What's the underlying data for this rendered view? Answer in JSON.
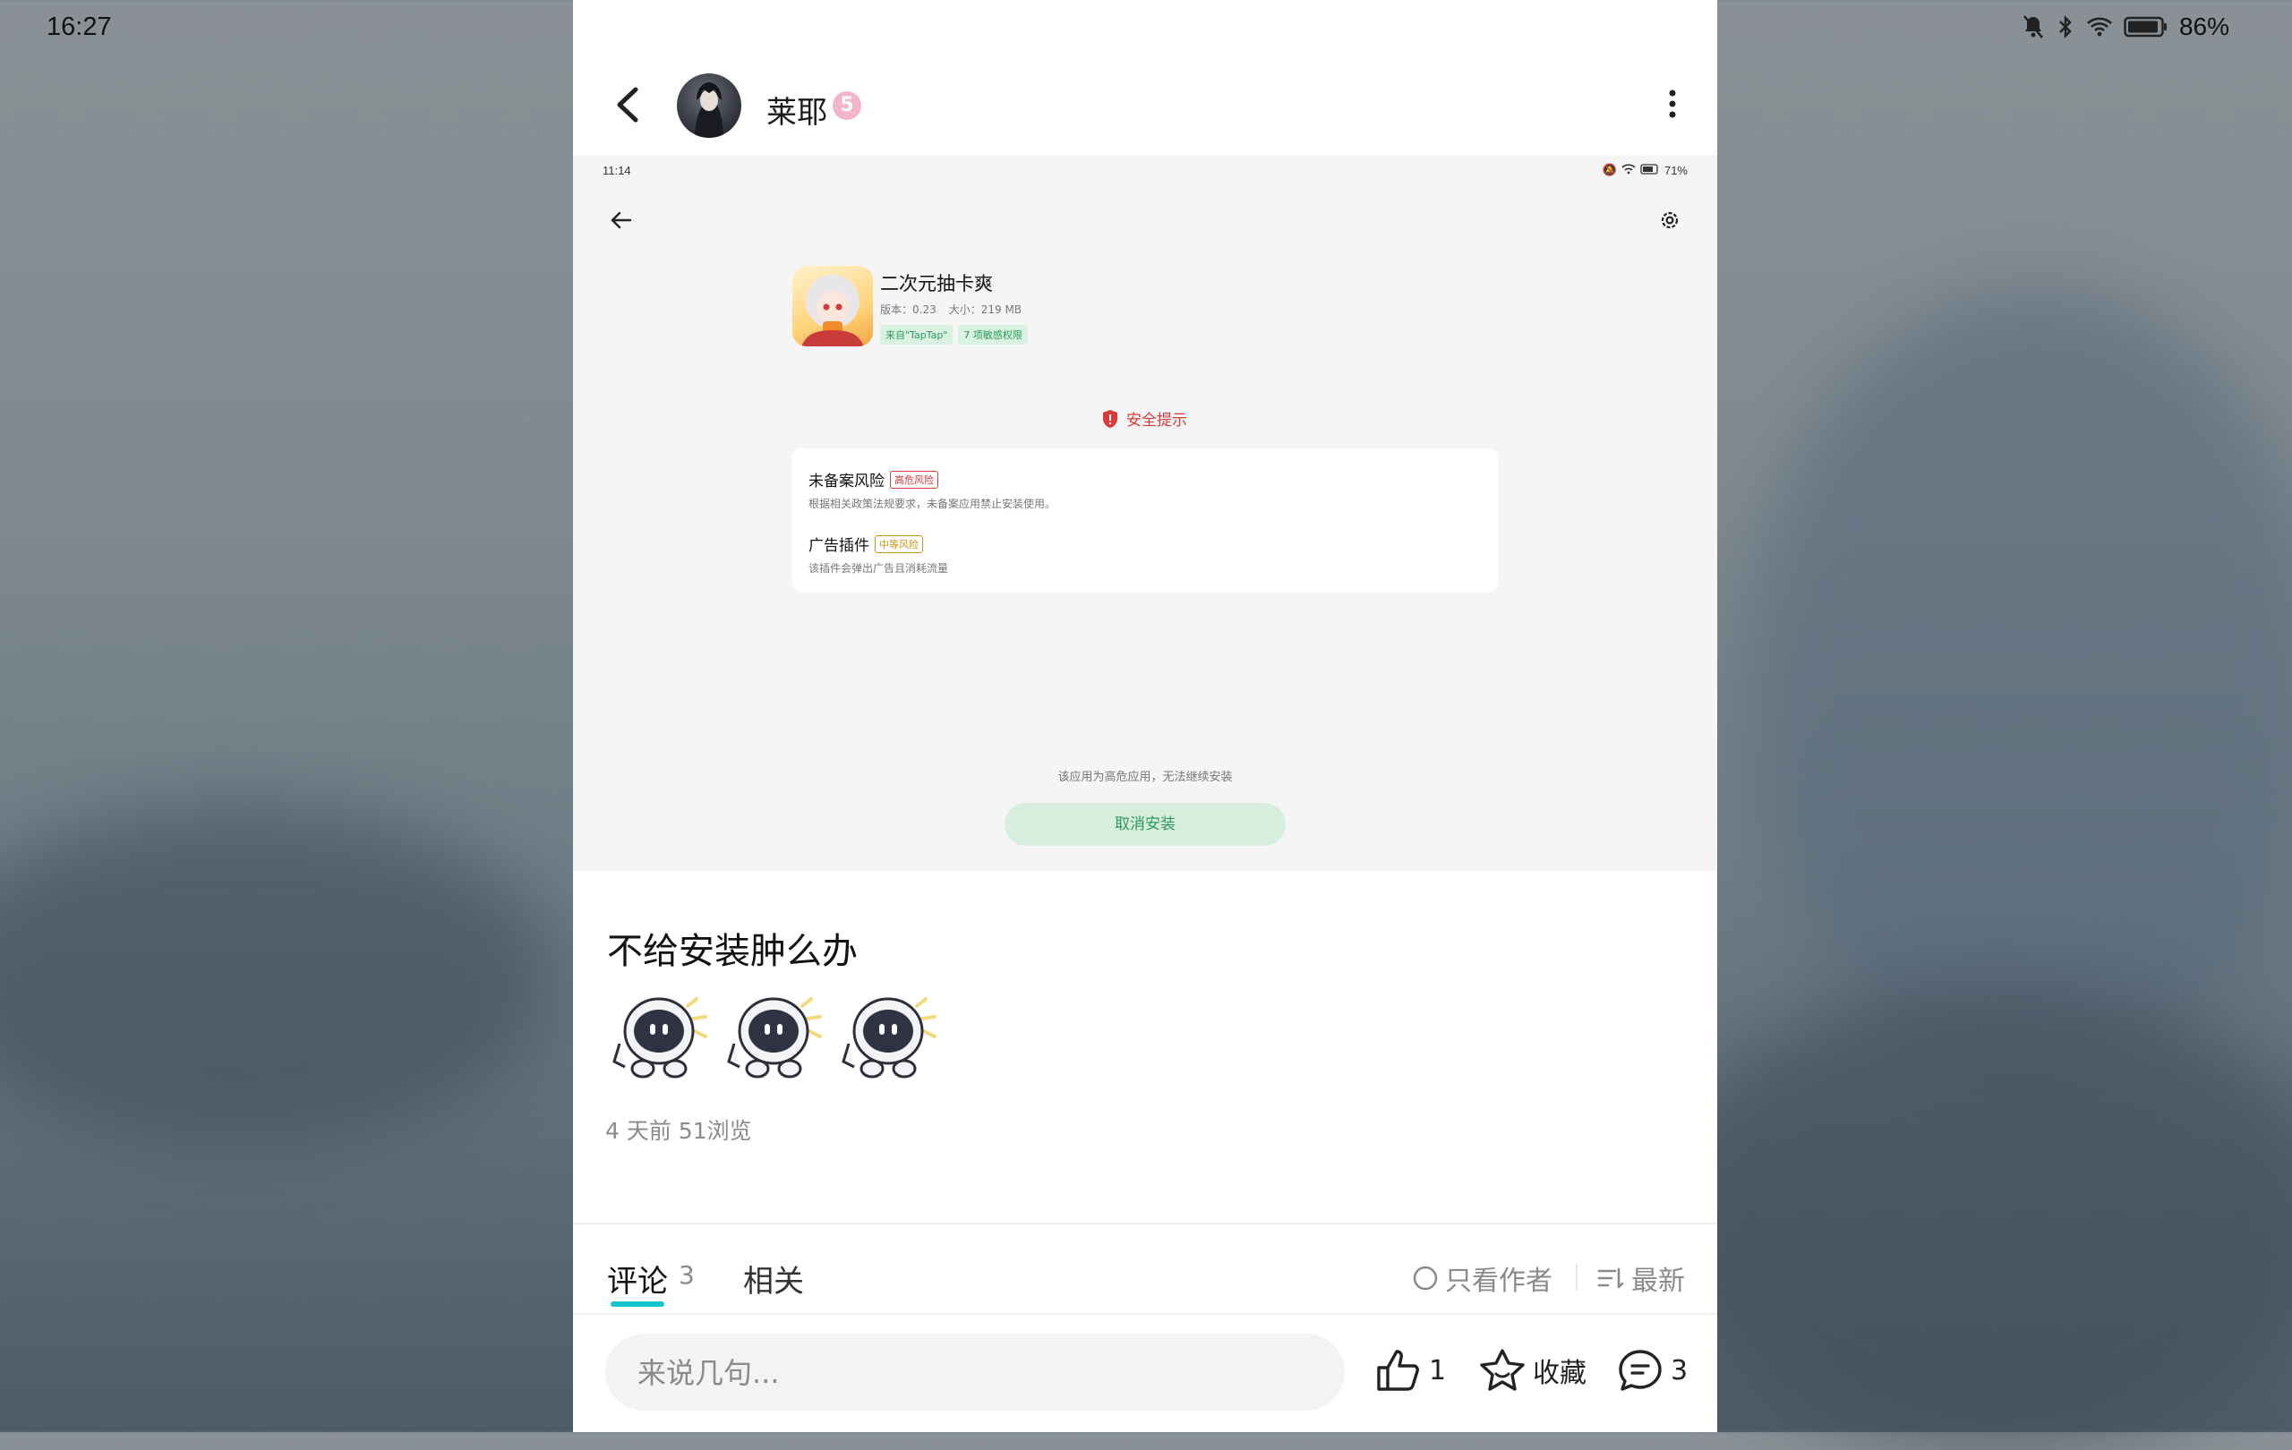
{
  "status_bar": {
    "time": "16:27",
    "battery": "86%"
  },
  "header": {
    "username": "莱耶",
    "level_badge": "5"
  },
  "embedded": {
    "time": "11:14",
    "battery": "71%",
    "app_name": "二次元抽卡爽",
    "version": "版本：0.23",
    "size": "大小：219 MB",
    "tags": [
      "来自\"TapTap\"",
      "7 项敏感权限"
    ],
    "safety_title": "安全提示",
    "risks": [
      {
        "title": "未备案风险",
        "badge": "高危风险",
        "badge_color": "#d93a3a",
        "desc": "根据相关政策法规要求，未备案应用禁止安装使用。"
      },
      {
        "title": "广告插件",
        "badge": "中等风险",
        "badge_color": "#c9961a",
        "desc": "该插件会弹出广告且消耗流量"
      }
    ],
    "note": "该应用为高危应用，无法继续安装",
    "cancel_button": "取消安装"
  },
  "post": {
    "title": "不给安装肿么办",
    "meta": "4 天前  51浏览"
  },
  "tabs": {
    "comments_label": "评论",
    "comments_count": "3",
    "related_label": "相关",
    "only_author": "只看作者",
    "sort": "最新"
  },
  "bottom": {
    "comment_placeholder": "来说几句...",
    "likes": "1",
    "favorite": "收藏",
    "comments": "3"
  },
  "colors": {
    "accent": "#15c5ce",
    "danger": "#d93a3a",
    "green": "#2c9a57"
  }
}
